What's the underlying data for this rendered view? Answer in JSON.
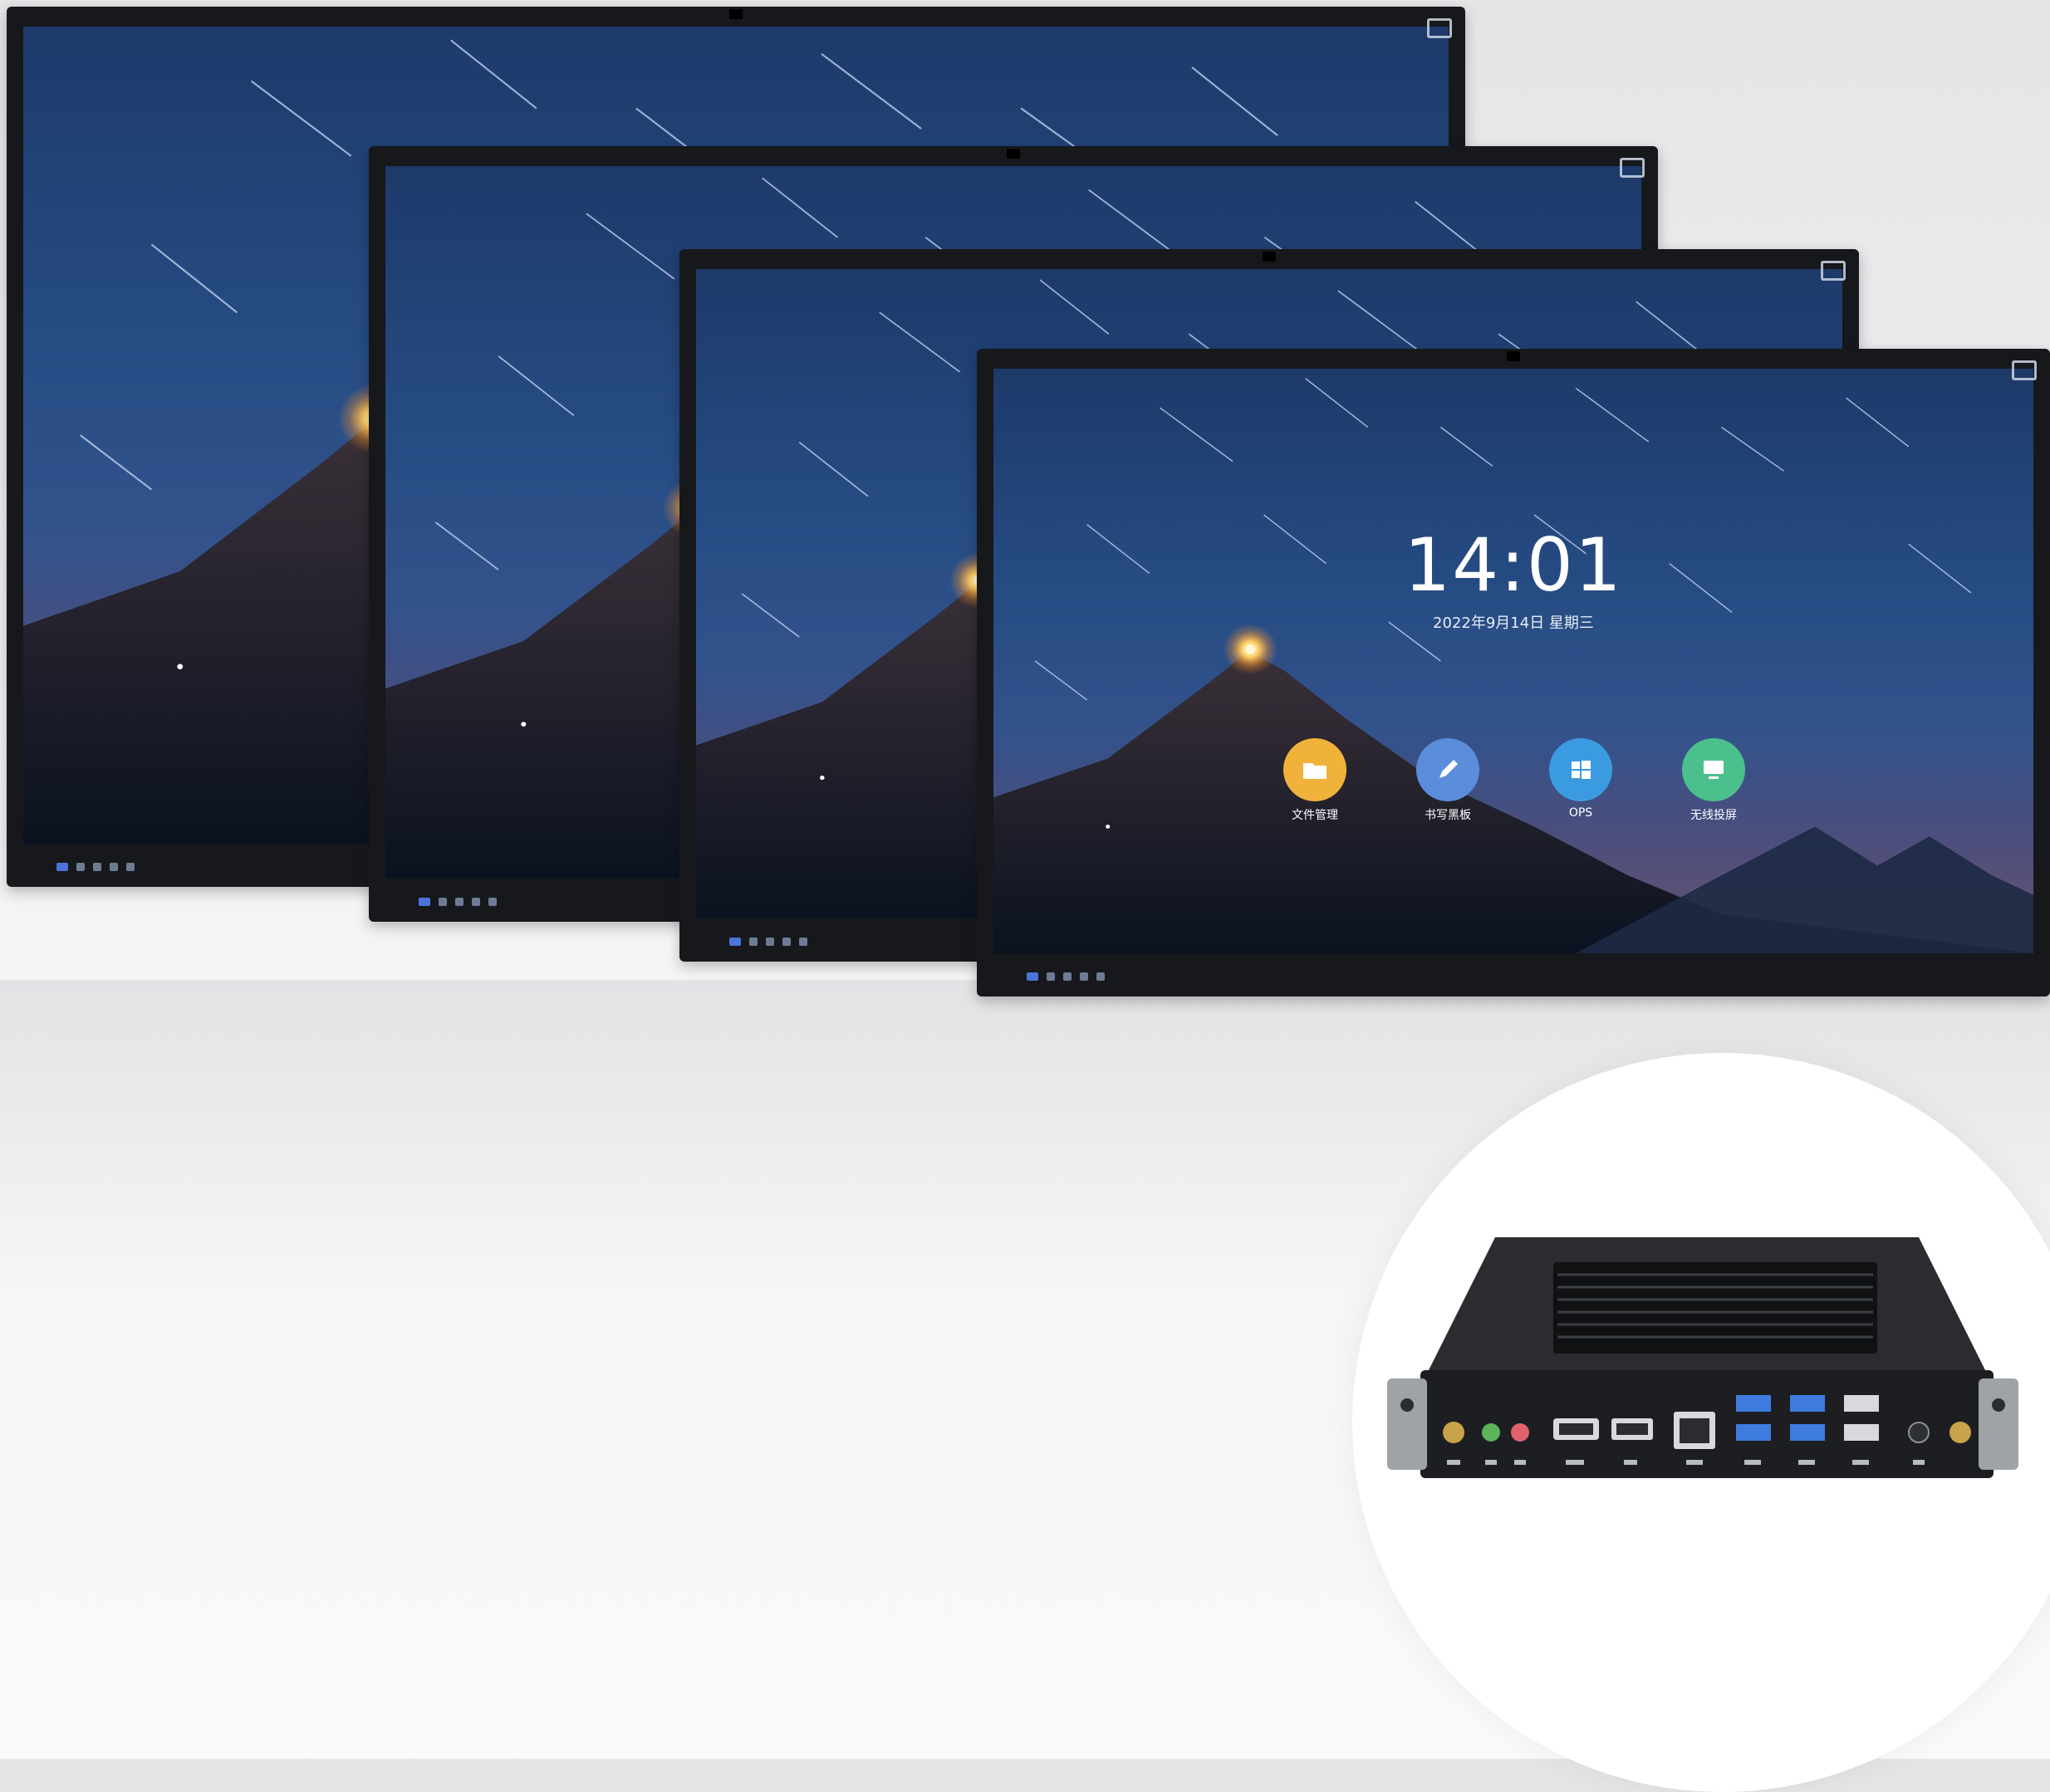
{
  "displays": [
    {
      "id": "tv1"
    },
    {
      "id": "tv2"
    },
    {
      "id": "tv3"
    },
    {
      "id": "tv4"
    }
  ],
  "home_screen": {
    "time": "14:01",
    "date": "2022年9月14日  星期三",
    "apps": [
      {
        "label": "文件管理",
        "color": "#f0b23a",
        "icon": "folder-icon"
      },
      {
        "label": "书写黑板",
        "color": "#5b8ddb",
        "icon": "pen-icon"
      },
      {
        "label": "OPS",
        "color": "#3b9be0",
        "icon": "windows-icon"
      },
      {
        "label": "无线投屏",
        "color": "#4cc08c",
        "icon": "screen-cast-icon"
      }
    ]
  },
  "ops_module": {
    "port_icons": [
      "antenna-icon",
      "headphone-icon",
      "mic-icon",
      "hdmi-icon",
      "displayport-icon",
      "ethernet-icon",
      "usb-icon",
      "power-icon"
    ]
  }
}
